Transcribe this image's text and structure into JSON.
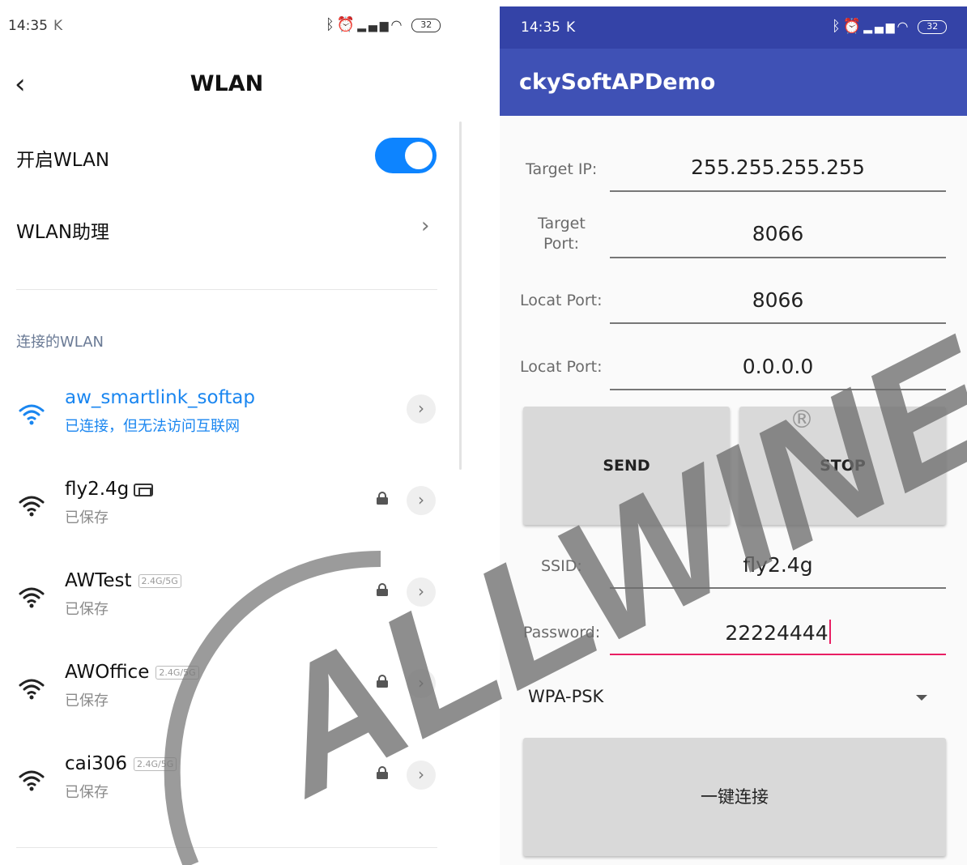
{
  "left_phone": {
    "status_bar": {
      "time": "14:35",
      "carrier_mark": "K",
      "battery": "32",
      "icons": [
        "bluetooth-icon",
        "alarm-icon",
        "signal-icon",
        "wifi-icon",
        "battery-icon"
      ]
    },
    "header": {
      "title": "WLAN",
      "back_icon": "back-arrow-icon"
    },
    "wlan_toggle": {
      "label": "开启WLAN",
      "on": true,
      "color": "#0d84ff"
    },
    "assistant": {
      "label": "WLAN助理"
    },
    "section_label": "连接的WLAN",
    "networks": [
      {
        "name": "aw_smartlink_softap",
        "status": "已连接，但无法访问互联网",
        "connected": true,
        "badge": "",
        "locked": false
      },
      {
        "name": "fly2.4g",
        "status": "已保存",
        "connected": false,
        "badge": "mi",
        "locked": true
      },
      {
        "name": "AWTest",
        "status": "已保存",
        "connected": false,
        "badge": "2.4G/5G",
        "locked": true
      },
      {
        "name": "AWOffice",
        "status": "已保存",
        "connected": false,
        "badge": "2.4G/5G",
        "locked": true
      },
      {
        "name": "cai306",
        "status": "已保存",
        "connected": false,
        "badge": "2.4G/5G",
        "locked": true
      }
    ],
    "accent_color": "#1a86f0"
  },
  "right_phone": {
    "status_bar": {
      "time": "14:35",
      "carrier_mark": "K",
      "battery": "32"
    },
    "app_title": "ckySoftAPDemo",
    "appbar_color": "#3f51b5",
    "fields": [
      {
        "label": "Target IP:",
        "value": "255.255.255.255"
      },
      {
        "label_line1": "Target",
        "label_line2": "Port:",
        "value": "8066"
      },
      {
        "label": "Locat Port:",
        "value": "8066"
      },
      {
        "label": "Locat Port:",
        "value": "0.0.0.0"
      }
    ],
    "buttons": {
      "send": "SEND",
      "stop": "STOP",
      "connect": "一键连接"
    },
    "ssid": {
      "label": "SSID:",
      "value": "fly2.4g"
    },
    "password": {
      "label": "Password:",
      "value": "22224444",
      "focused_color": "#e91e63"
    },
    "security_spinner": {
      "selected": "WPA-PSK"
    }
  },
  "watermark": {
    "text": "ALLWINER",
    "registered_mark": "®"
  }
}
